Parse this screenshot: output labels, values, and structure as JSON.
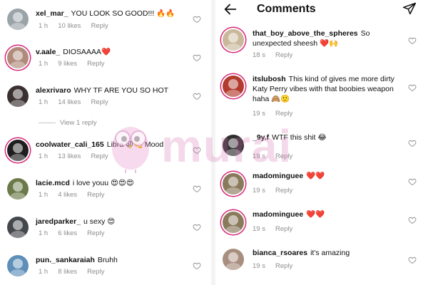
{
  "left_comments": [
    {
      "username": "xel_mar_",
      "text": "YOU LOOK SO GOOD!!! 🔥🔥",
      "time": "1 h",
      "likes": "10 likes",
      "reply": "Reply"
    },
    {
      "username": "v.aale_",
      "text": "DIOSAAAA❤️",
      "time": "1 h",
      "likes": "9 likes",
      "reply": "Reply"
    },
    {
      "username": "alexrivaro",
      "text": "WHY TF ARE YOU SO HOT",
      "time": "1 h",
      "likes": "14 likes",
      "reply": "Reply"
    },
    {
      "username": "coolwater_cali_165",
      "text": "Libra 😩💫 Mood",
      "time": "1 h",
      "likes": "13 likes",
      "reply": "Reply"
    },
    {
      "username": "lacie.mcd",
      "text": "i love youu 😍😍😍",
      "time": "1 h",
      "likes": "4 likes",
      "reply": "Reply"
    },
    {
      "username": "jaredparker_",
      "text": "u sexy 😍",
      "time": "1 h",
      "likes": "6 likes",
      "reply": "Reply"
    },
    {
      "username": "pun._sankaraiah",
      "text": "Bruhh",
      "time": "1 h",
      "likes": "8 likes",
      "reply": "Reply"
    }
  ],
  "view_reply": "View 1 reply",
  "header": {
    "title": "Comments"
  },
  "right_comments": [
    {
      "username": "that_boy_above_the_spheres",
      "text": "So unexpected sheesh ❤️🙌",
      "time": "18 s",
      "reply": "Reply"
    },
    {
      "username": "itslubosh",
      "text": "This kind of gives me more dirty Katy Perry vibes with that boobies weapon haha 🙈🙂",
      "time": "19 s",
      "reply": "Reply"
    },
    {
      "username": "_9y.f",
      "text": "WTF this shit 😂",
      "time": "19 s",
      "reply": "Reply"
    },
    {
      "username": "madominguee",
      "text": "❤️❤️",
      "time": "19 s",
      "reply": "Reply"
    },
    {
      "username": "madominguee",
      "text": "❤️❤️",
      "time": "19 s",
      "reply": "Reply"
    },
    {
      "username": "bianca_rsoares",
      "text": "it's amazing",
      "time": "19 s",
      "reply": "Reply"
    }
  ],
  "watermark": {
    "text": "murai"
  },
  "icons": {
    "back": "back-arrow-icon",
    "send": "send-icon",
    "like": "heart-icon"
  },
  "colors": {
    "story_ring": "#d6287a",
    "meta_gray": "#8e8e8e",
    "watermark": "#d678b2"
  }
}
